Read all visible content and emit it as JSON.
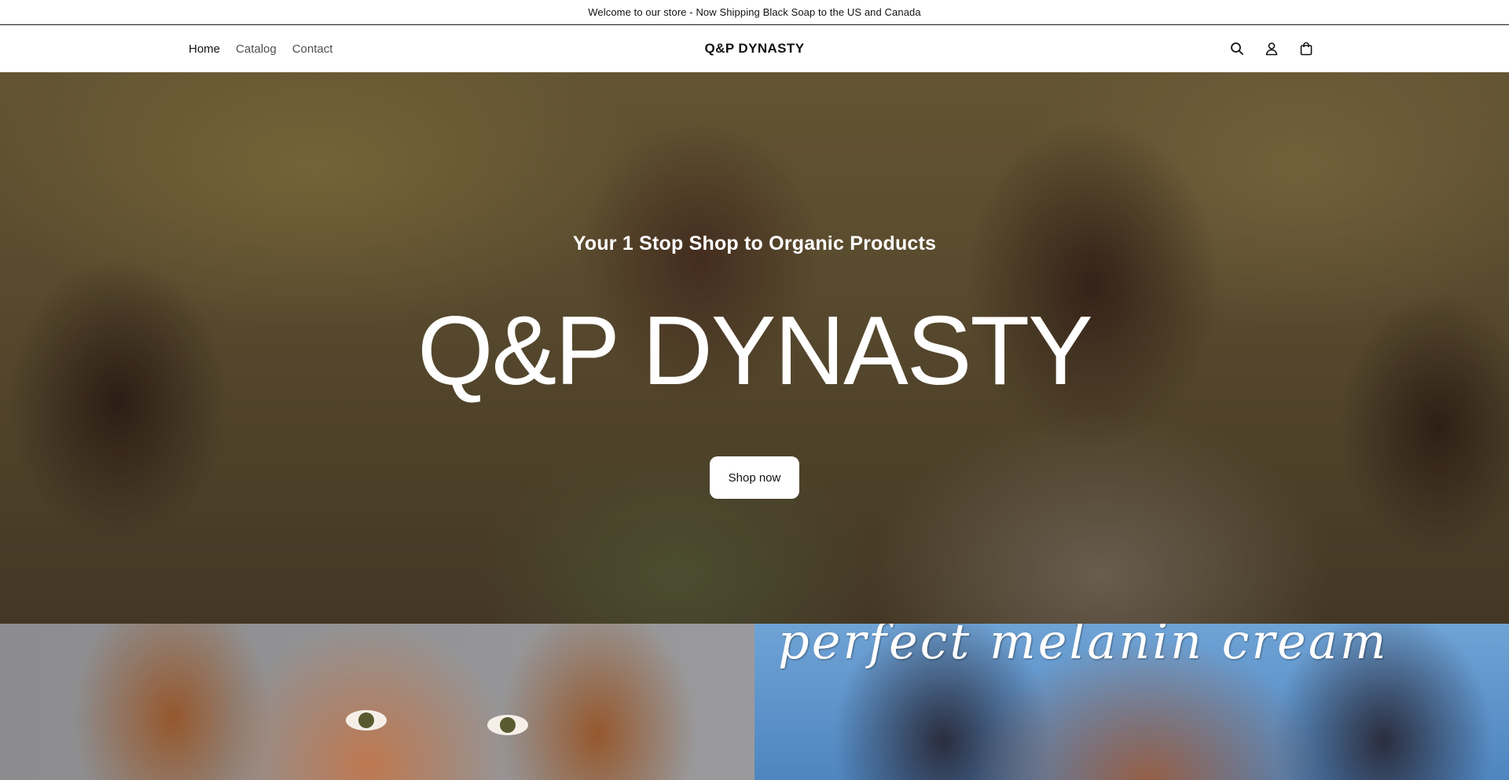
{
  "announcement": {
    "text": "Welcome to our store - Now Shipping Black Soap to the US and Canada"
  },
  "header": {
    "nav": [
      {
        "label": "Home"
      },
      {
        "label": "Catalog"
      },
      {
        "label": "Contact"
      }
    ],
    "logo": "Q&P DYNASTY",
    "icons": [
      "search-icon",
      "account-icon",
      "cart-icon"
    ]
  },
  "hero": {
    "subheading": "Your 1 Stop Shop to Organic Products",
    "heading": "Q&P DYNASTY",
    "button_label": "Shop now"
  },
  "tiles": {
    "right_caption": "perfect melanin cream"
  }
}
